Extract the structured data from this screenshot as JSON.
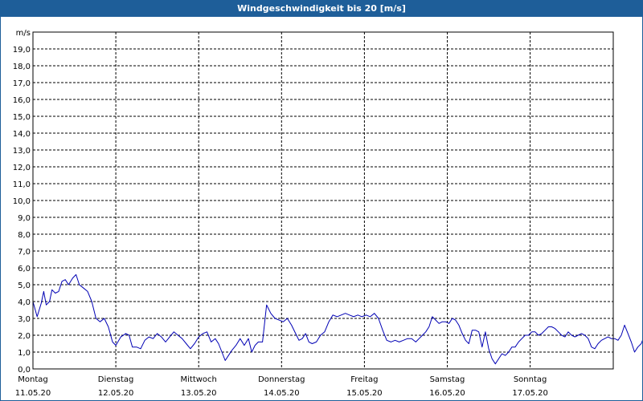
{
  "window": {
    "title": "Windgeschwindigkeit bis 20 [m/s]"
  },
  "colors": {
    "titlebar": "#1e5e99",
    "line": "#0000b4",
    "grid": "#000000"
  },
  "chart_data": {
    "type": "line",
    "title": "Windgeschwindigkeit bis 20 [m/s]",
    "ylabel": "m/s",
    "xlabel": "",
    "ylim": [
      0,
      20
    ],
    "xlim": [
      0,
      7
    ],
    "grid": true,
    "y_ticks": [
      "0,0",
      "1,0",
      "2,0",
      "3,0",
      "4,0",
      "5,0",
      "6,0",
      "7,0",
      "8,0",
      "9,0",
      "10,0",
      "11,0",
      "12,0",
      "13,0",
      "14,0",
      "15,0",
      "16,0",
      "17,0",
      "18,0",
      "19,0"
    ],
    "x_ticks": [
      {
        "pos": 0,
        "day": "Montag",
        "date": "11.05.20"
      },
      {
        "pos": 1,
        "day": "Dienstag",
        "date": "12.05.20"
      },
      {
        "pos": 2,
        "day": "Mittwoch",
        "date": "13.05.20"
      },
      {
        "pos": 3,
        "day": "Donnerstag",
        "date": "14.05.20"
      },
      {
        "pos": 4,
        "day": "Freitag",
        "date": "15.05.20"
      },
      {
        "pos": 5,
        "day": "Samstag",
        "date": "16.05.20"
      },
      {
        "pos": 6,
        "day": "Sonntag",
        "date": "17.05.20"
      }
    ],
    "series": [
      {
        "values": [
          [
            0.0,
            4.0
          ],
          [
            0.05,
            3.1
          ],
          [
            0.1,
            3.9
          ],
          [
            0.13,
            4.6
          ],
          [
            0.16,
            3.8
          ],
          [
            0.2,
            4.0
          ],
          [
            0.23,
            4.7
          ],
          [
            0.27,
            4.5
          ],
          [
            0.31,
            4.6
          ],
          [
            0.35,
            5.2
          ],
          [
            0.39,
            5.3
          ],
          [
            0.43,
            5.0
          ],
          [
            0.48,
            5.4
          ],
          [
            0.52,
            5.6
          ],
          [
            0.56,
            5.0
          ],
          [
            0.61,
            4.8
          ],
          [
            0.66,
            4.6
          ],
          [
            0.71,
            4.0
          ],
          [
            0.76,
            3.0
          ],
          [
            0.81,
            2.8
          ],
          [
            0.86,
            3.0
          ],
          [
            0.91,
            2.5
          ],
          [
            0.96,
            1.6
          ],
          [
            1.0,
            1.4
          ],
          [
            1.06,
            1.9
          ],
          [
            1.12,
            2.1
          ],
          [
            1.16,
            2.0
          ],
          [
            1.2,
            1.3
          ],
          [
            1.25,
            1.3
          ],
          [
            1.3,
            1.2
          ],
          [
            1.35,
            1.7
          ],
          [
            1.4,
            1.9
          ],
          [
            1.45,
            1.8
          ],
          [
            1.5,
            2.1
          ],
          [
            1.55,
            1.9
          ],
          [
            1.6,
            1.6
          ],
          [
            1.65,
            1.9
          ],
          [
            1.7,
            2.2
          ],
          [
            1.75,
            2.0
          ],
          [
            1.8,
            1.8
          ],
          [
            1.85,
            1.5
          ],
          [
            1.9,
            1.2
          ],
          [
            1.95,
            1.5
          ],
          [
            2.0,
            1.9
          ],
          [
            2.05,
            2.1
          ],
          [
            2.1,
            2.2
          ],
          [
            2.15,
            1.6
          ],
          [
            2.2,
            1.8
          ],
          [
            2.24,
            1.5
          ],
          [
            2.28,
            1.0
          ],
          [
            2.32,
            0.5
          ],
          [
            2.36,
            0.8
          ],
          [
            2.4,
            1.1
          ],
          [
            2.45,
            1.4
          ],
          [
            2.5,
            1.8
          ],
          [
            2.55,
            1.4
          ],
          [
            2.6,
            1.8
          ],
          [
            2.64,
            1.0
          ],
          [
            2.68,
            1.4
          ],
          [
            2.72,
            1.6
          ],
          [
            2.77,
            1.6
          ],
          [
            2.82,
            3.8
          ],
          [
            2.87,
            3.3
          ],
          [
            2.92,
            3.0
          ],
          [
            2.97,
            2.9
          ],
          [
            3.02,
            2.8
          ],
          [
            3.07,
            3.0
          ],
          [
            3.12,
            2.6
          ],
          [
            3.17,
            2.1
          ],
          [
            3.21,
            1.7
          ],
          [
            3.25,
            1.8
          ],
          [
            3.29,
            2.1
          ],
          [
            3.33,
            1.6
          ],
          [
            3.37,
            1.5
          ],
          [
            3.42,
            1.6
          ],
          [
            3.47,
            2.0
          ],
          [
            3.52,
            2.2
          ],
          [
            3.57,
            2.8
          ],
          [
            3.62,
            3.2
          ],
          [
            3.67,
            3.1
          ],
          [
            3.72,
            3.2
          ],
          [
            3.77,
            3.3
          ],
          [
            3.82,
            3.2
          ],
          [
            3.87,
            3.1
          ],
          [
            3.92,
            3.2
          ],
          [
            3.97,
            3.1
          ],
          [
            4.02,
            3.2
          ],
          [
            4.07,
            3.1
          ],
          [
            4.12,
            3.3
          ],
          [
            4.17,
            3.0
          ],
          [
            4.22,
            2.3
          ],
          [
            4.27,
            1.7
          ],
          [
            4.32,
            1.6
          ],
          [
            4.37,
            1.7
          ],
          [
            4.42,
            1.6
          ],
          [
            4.47,
            1.7
          ],
          [
            4.52,
            1.8
          ],
          [
            4.57,
            1.8
          ],
          [
            4.62,
            1.6
          ],
          [
            4.66,
            1.8
          ],
          [
            4.7,
            2.0
          ],
          [
            4.74,
            2.2
          ],
          [
            4.78,
            2.5
          ],
          [
            4.82,
            3.1
          ],
          [
            4.86,
            2.9
          ],
          [
            4.9,
            2.7
          ],
          [
            4.94,
            2.8
          ],
          [
            4.98,
            2.8
          ],
          [
            5.02,
            2.7
          ],
          [
            5.06,
            3.0
          ],
          [
            5.1,
            2.9
          ],
          [
            5.14,
            2.6
          ],
          [
            5.18,
            2.1
          ],
          [
            5.22,
            1.7
          ],
          [
            5.26,
            1.5
          ],
          [
            5.3,
            2.3
          ],
          [
            5.34,
            2.3
          ],
          [
            5.38,
            2.2
          ],
          [
            5.42,
            1.3
          ],
          [
            5.46,
            2.2
          ],
          [
            5.5,
            1.2
          ],
          [
            5.54,
            0.6
          ],
          [
            5.58,
            0.3
          ],
          [
            5.62,
            0.6
          ],
          [
            5.66,
            0.9
          ],
          [
            5.7,
            0.8
          ],
          [
            5.74,
            1.0
          ],
          [
            5.78,
            1.3
          ],
          [
            5.82,
            1.3
          ],
          [
            5.86,
            1.6
          ],
          [
            5.9,
            1.8
          ],
          [
            5.94,
            2.0
          ],
          [
            5.98,
            2.0
          ],
          [
            6.02,
            2.2
          ],
          [
            6.06,
            2.2
          ],
          [
            6.1,
            2.0
          ],
          [
            6.14,
            2.1
          ],
          [
            6.18,
            2.3
          ],
          [
            6.22,
            2.5
          ],
          [
            6.26,
            2.5
          ],
          [
            6.3,
            2.4
          ],
          [
            6.34,
            2.2
          ],
          [
            6.38,
            2.0
          ],
          [
            6.42,
            1.9
          ],
          [
            6.46,
            2.2
          ],
          [
            6.5,
            2.0
          ],
          [
            6.54,
            1.9
          ],
          [
            6.58,
            2.0
          ],
          [
            6.62,
            2.1
          ],
          [
            6.66,
            2.0
          ],
          [
            6.7,
            1.8
          ],
          [
            6.74,
            1.3
          ],
          [
            6.78,
            1.2
          ],
          [
            6.82,
            1.5
          ],
          [
            6.86,
            1.7
          ],
          [
            6.9,
            1.8
          ],
          [
            6.94,
            1.9
          ],
          [
            6.98,
            1.8
          ],
          [
            7.02,
            1.8
          ],
          [
            7.06,
            1.7
          ],
          [
            7.1,
            2.0
          ],
          [
            7.14,
            2.6
          ],
          [
            7.18,
            2.1
          ],
          [
            7.22,
            1.6
          ],
          [
            7.26,
            1.0
          ],
          [
            7.3,
            1.3
          ],
          [
            7.34,
            1.5
          ],
          [
            7.38,
            2.0
          ],
          [
            7.42,
            3.2
          ]
        ]
      }
    ]
  }
}
